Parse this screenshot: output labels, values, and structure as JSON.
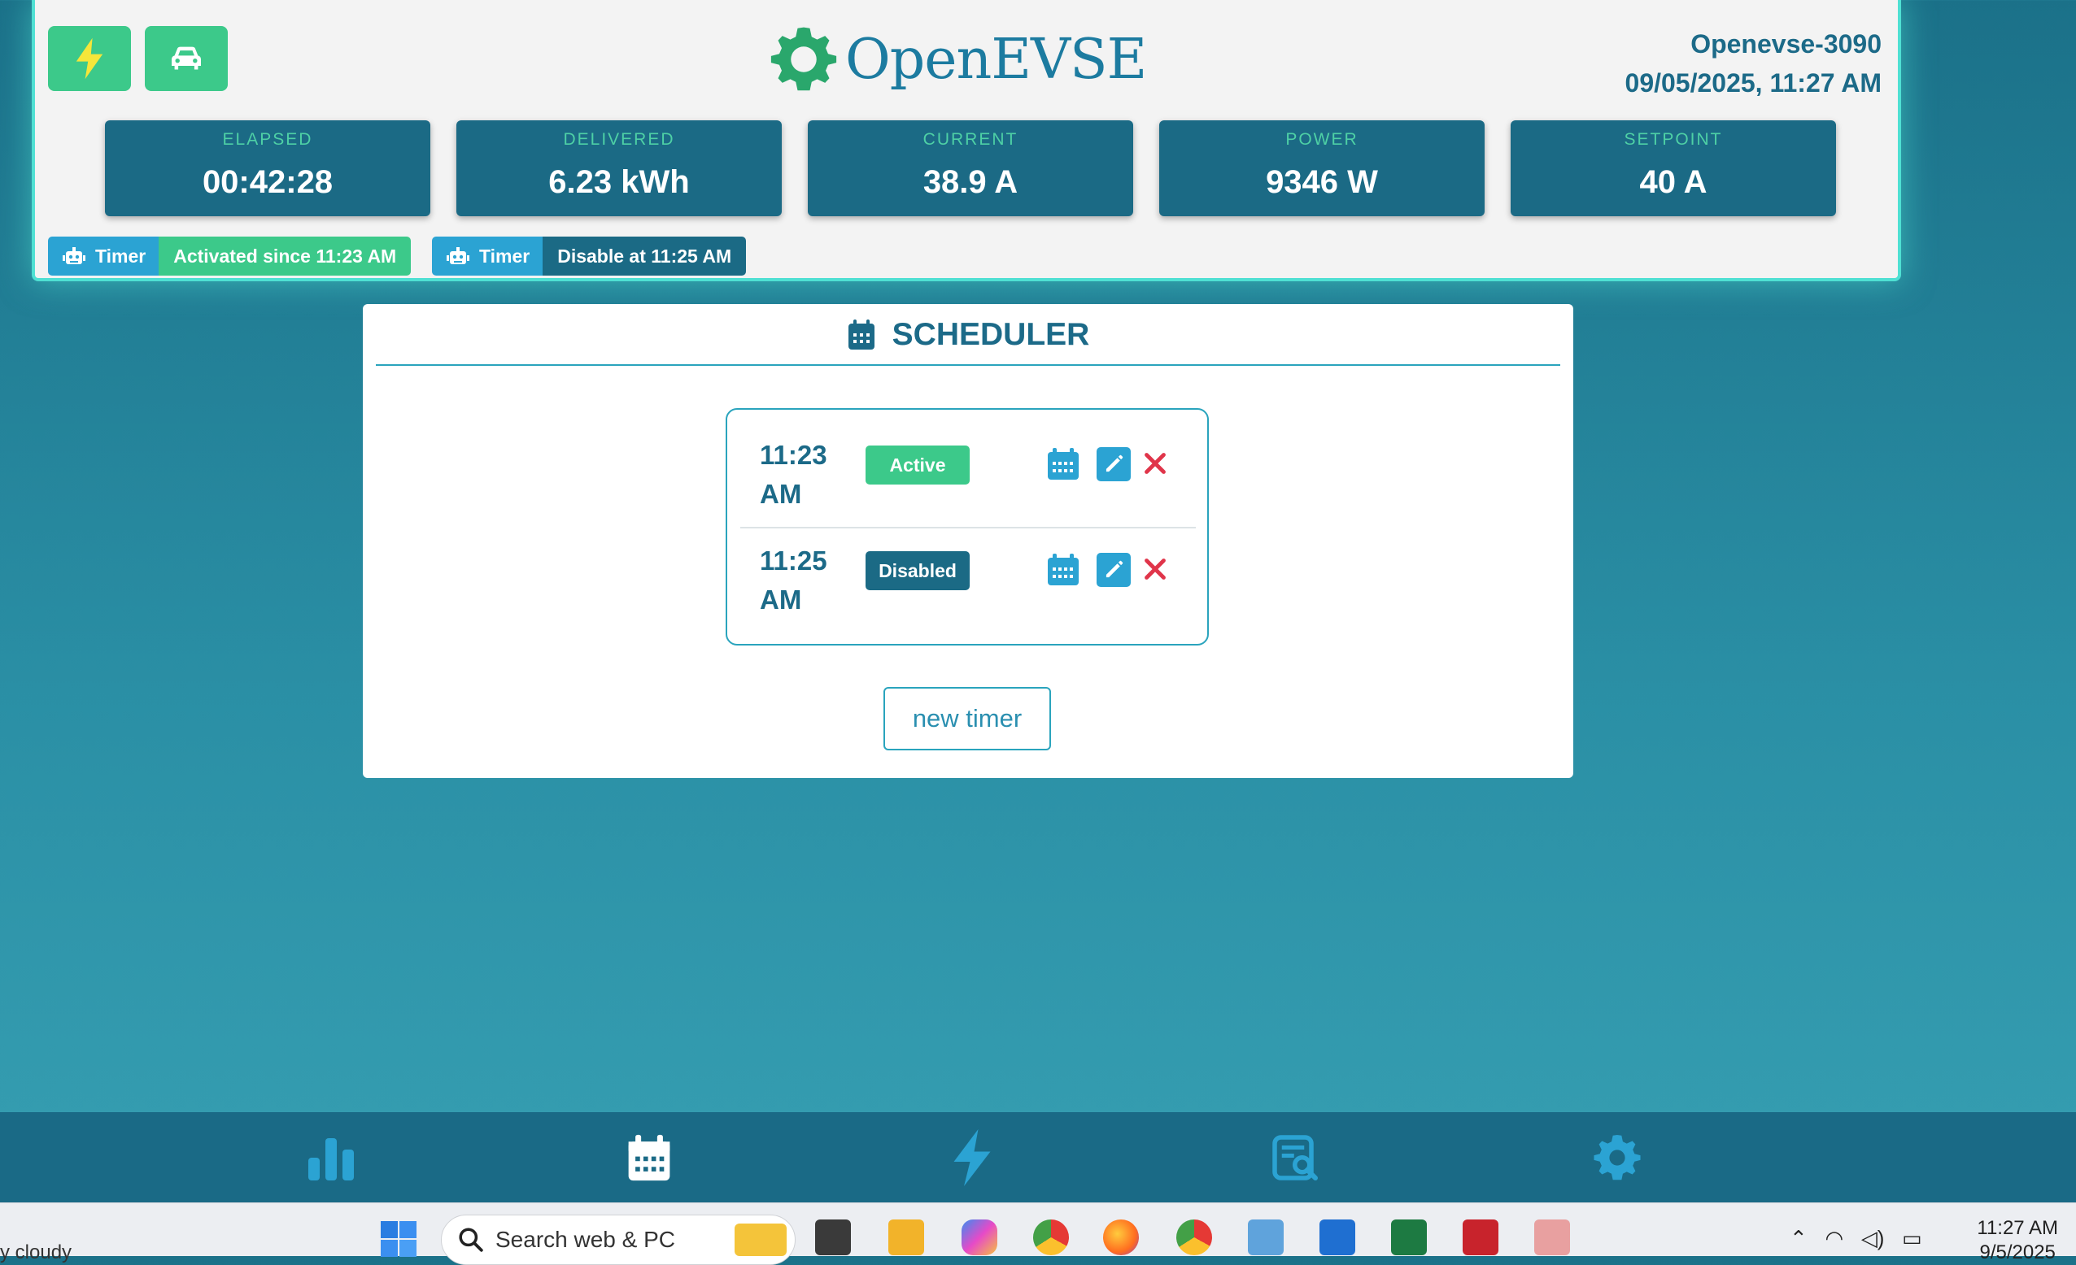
{
  "header": {
    "charge_button_icon": "lightning-icon",
    "vehicle_button_icon": "car-icon",
    "logo_text": "OpenEVSE",
    "device_name": "Openevse-3090",
    "datetime": "09/05/2025, 11:27 AM"
  },
  "stats": [
    {
      "label": "ELAPSED",
      "value": "00:42:28"
    },
    {
      "label": "DELIVERED",
      "value": "6.23 kWh"
    },
    {
      "label": "CURRENT",
      "value": "38.9 A"
    },
    {
      "label": "POWER",
      "value": "9346 W"
    },
    {
      "label": "SETPOINT",
      "value": "40 A"
    }
  ],
  "status_pills": [
    {
      "label": "Timer",
      "text": "Activated since 11:23 AM",
      "color": "#3cc98a"
    },
    {
      "label": "Timer",
      "text": "Disable at 11:25 AM",
      "color": "#1b6a85"
    }
  ],
  "scheduler": {
    "title": "SCHEDULER",
    "timers": [
      {
        "time": "11:23 AM",
        "status": "Active",
        "status_color": "#3cc98a"
      },
      {
        "time": "11:25 AM",
        "status": "Disabled",
        "status_color": "#1b6a85"
      }
    ],
    "new_timer_label": "new timer"
  },
  "bottom_nav": [
    "chart-icon",
    "calendar-icon",
    "lightning-icon",
    "log-search-icon",
    "gear-icon"
  ],
  "taskbar": {
    "weather_text": "y cloudy",
    "search_placeholder": "Search web & PC",
    "time": "11:27 AM",
    "date": "9/5/2025"
  },
  "colors": {
    "accent": "#1c6a88",
    "green": "#3cc98a",
    "blue": "#2ba3d3",
    "delete": "#e0354a"
  }
}
